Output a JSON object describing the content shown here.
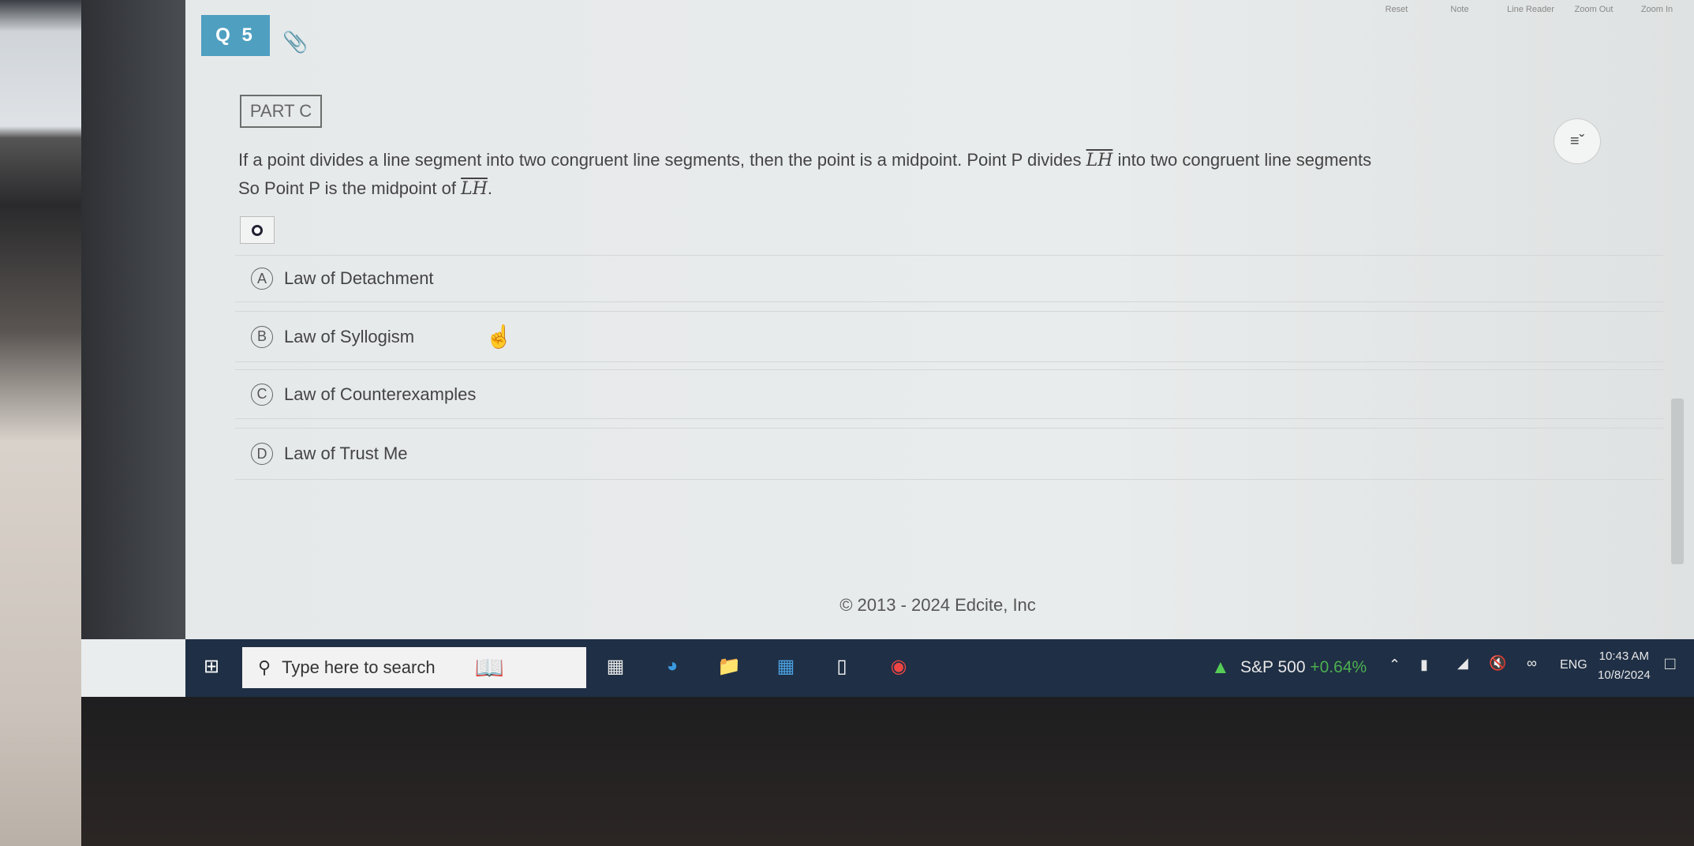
{
  "toolbar": {
    "reset": "Reset",
    "note": "Note",
    "line_reader": "Line Reader",
    "zoom_out": "Zoom Out",
    "zoom_in": "Zoom In"
  },
  "question": {
    "number": "Q 5",
    "part": "PART C",
    "line1_before": "If a point divides a line segment into two congruent line segments, then the point is a midpoint. Point P divides ",
    "segment": "LH",
    "line1_after": " into two congruent line segments",
    "line2_before": "So Point P is the midpoint of ",
    "line2_after": "."
  },
  "options": [
    {
      "letter": "A",
      "label": "Law of Detachment"
    },
    {
      "letter": "B",
      "label": "Law of Syllogism"
    },
    {
      "letter": "C",
      "label": "Law of Counterexamples"
    },
    {
      "letter": "D",
      "label": "Law of Trust Me"
    }
  ],
  "footer": {
    "copyright": "© 2013 - 2024 Edcite, Inc"
  },
  "taskbar": {
    "search_placeholder": "Type here to search",
    "stock_name": "S&P 500",
    "stock_change": "+0.64%",
    "stock_color": "#4caf50",
    "language": "ENG",
    "time": "10:43 AM",
    "date": "10/8/2024"
  },
  "colors": {
    "badge": "#4f9fc0",
    "taskbar": "#1f2f45"
  }
}
